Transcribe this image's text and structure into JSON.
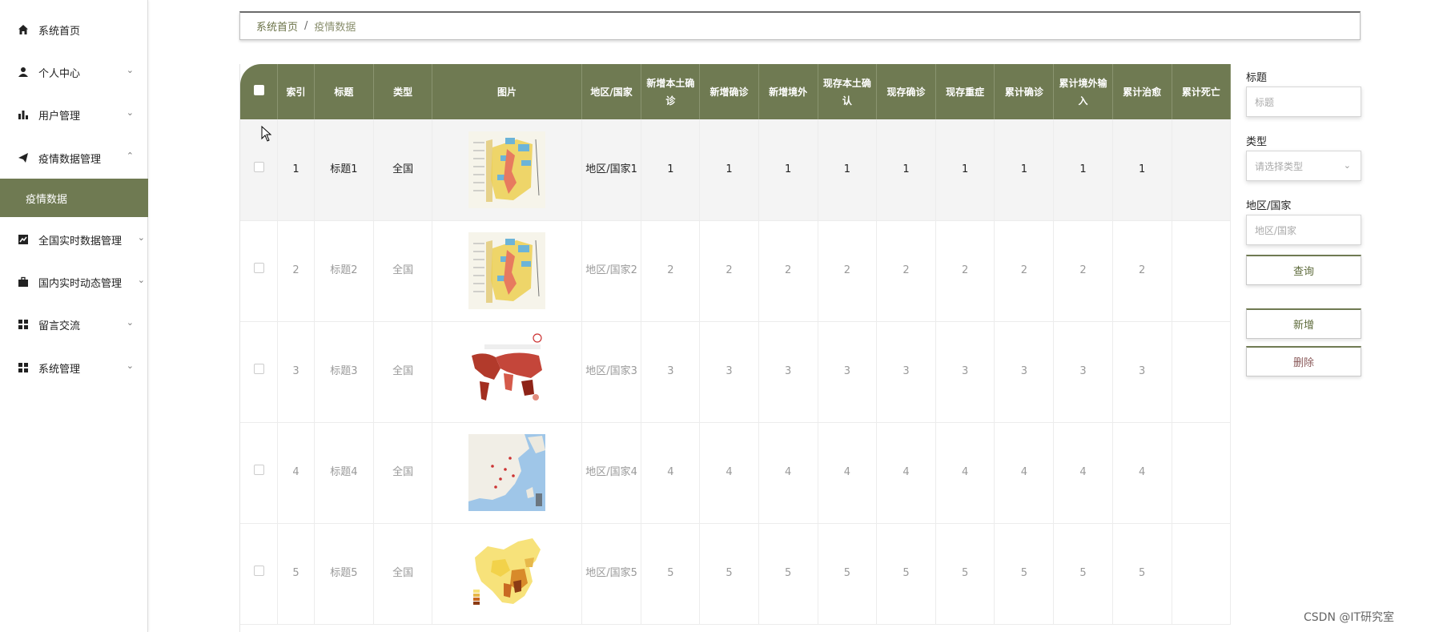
{
  "sidebar": {
    "items": [
      {
        "label": "系统首页",
        "icon": "home-icon",
        "arrow": ""
      },
      {
        "label": "个人中心",
        "icon": "user-icon",
        "arrow": "⌄"
      },
      {
        "label": "用户管理",
        "icon": "bar-chart-icon",
        "arrow": "⌄"
      },
      {
        "label": "疫情数据管理",
        "icon": "send-icon",
        "arrow": "⌃"
      },
      {
        "label": "全国实时数据管理",
        "icon": "line-chart-icon",
        "arrow": "⌄"
      },
      {
        "label": "国内实时动态管理",
        "icon": "briefcase-icon",
        "arrow": "⌄"
      },
      {
        "label": "留言交流",
        "icon": "grid-icon",
        "arrow": "⌄"
      },
      {
        "label": "系统管理",
        "icon": "grid-icon",
        "arrow": "⌄"
      }
    ],
    "active_sub": "疫情数据"
  },
  "breadcrumb": {
    "home": "系统首页",
    "separator": "/",
    "current": "疫情数据"
  },
  "table": {
    "headers": [
      "索引",
      "标题",
      "类型",
      "图片",
      "地区/国家",
      "新增本土确诊",
      "新增确诊",
      "新增境外",
      "现存本土确认",
      "现存确诊",
      "现存重症",
      "累计确诊",
      "累计境外输入",
      "累计治愈",
      "累计死亡"
    ],
    "rows": [
      {
        "index": "1",
        "title": "标题1",
        "type": "全国",
        "image": "density-map-1",
        "region": "地区/国家1",
        "vals": [
          "1",
          "1",
          "1",
          "1",
          "1",
          "1",
          "1",
          "1",
          "1"
        ]
      },
      {
        "index": "2",
        "title": "标题2",
        "type": "全国",
        "image": "density-map-2",
        "region": "地区/国家2",
        "vals": [
          "2",
          "2",
          "2",
          "2",
          "2",
          "2",
          "2",
          "2",
          "2"
        ]
      },
      {
        "index": "3",
        "title": "标题3",
        "type": "全国",
        "image": "world-map",
        "region": "地区/国家3",
        "vals": [
          "3",
          "3",
          "3",
          "3",
          "3",
          "3",
          "3",
          "3",
          "3"
        ]
      },
      {
        "index": "4",
        "title": "标题4",
        "type": "全国",
        "image": "china-terrain-map",
        "region": "地区/国家4",
        "vals": [
          "4",
          "4",
          "4",
          "4",
          "4",
          "4",
          "4",
          "4",
          "4"
        ]
      },
      {
        "index": "5",
        "title": "标题5",
        "type": "全国",
        "image": "china-heat-map",
        "region": "地区/国家5",
        "vals": [
          "5",
          "5",
          "5",
          "5",
          "5",
          "5",
          "5",
          "5",
          "5"
        ]
      }
    ]
  },
  "search": {
    "title_label": "标题",
    "title_placeholder": "标题",
    "type_label": "类型",
    "type_placeholder": "请选择类型",
    "region_label": "地区/国家",
    "region_placeholder": "地区/国家",
    "query_button": "查询",
    "add_button": "新增",
    "delete_button": "删除"
  },
  "watermark": "CSDN @IT研究室",
  "colors": {
    "accent": "#6f7a52"
  }
}
